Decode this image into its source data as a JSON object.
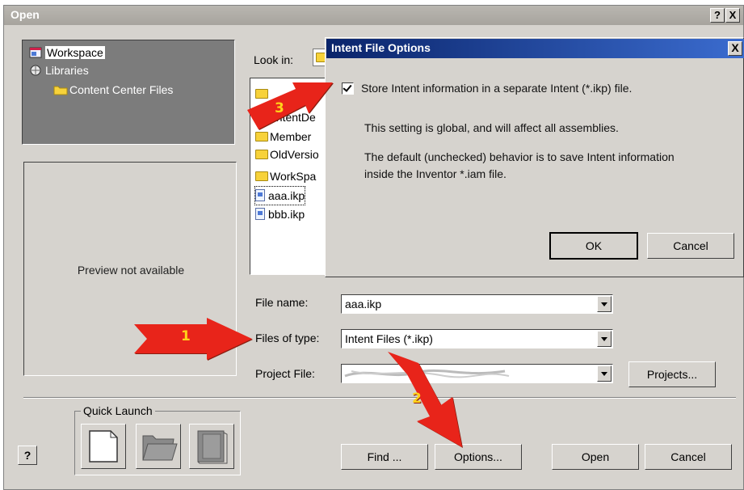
{
  "window": {
    "title": "Open",
    "help_button": "?",
    "close_button": "X"
  },
  "project_tree": {
    "items": [
      {
        "label": "Workspace",
        "icon": "workspace-icon"
      },
      {
        "label": "Libraries",
        "icon": "libraries-icon"
      },
      {
        "label": "Content Center Files",
        "icon": "folder-icon"
      }
    ]
  },
  "preview": {
    "text": "Preview not available"
  },
  "browser": {
    "look_in_label": "Look in:",
    "files": [
      {
        "name": "",
        "type": "folder"
      },
      {
        "name": "ontentDe",
        "type": "folder"
      },
      {
        "name": "Member",
        "type": "folder"
      },
      {
        "name": "OldVersio",
        "type": "folder"
      },
      {
        "name": "WorkSpa",
        "type": "folder"
      },
      {
        "name": "aaa.ikp",
        "type": "file"
      },
      {
        "name": "bbb.ikp",
        "type": "file"
      }
    ]
  },
  "fields": {
    "file_name_label": "File name:",
    "file_name_value": "aaa.ikp",
    "files_of_type_label": "Files of type:",
    "files_of_type_value": "Intent Files (*.ikp)",
    "project_file_label": "Project File:",
    "project_file_value": "",
    "projects_button": "Projects..."
  },
  "quick_launch": {
    "label": "Quick Launch"
  },
  "buttons": {
    "help": "?",
    "find": "Find ...",
    "options": "Options...",
    "open": "Open",
    "cancel": "Cancel"
  },
  "intent_dialog": {
    "title": "Intent File Options",
    "close": "X",
    "checkbox_label": "Store Intent information in a separate Intent (*.ikp) file.",
    "checkbox_checked": true,
    "note_line1": "This setting is global, and will affect all assemblies.",
    "note_line2": "The default (unchecked) behavior is to save Intent information",
    "note_line3": "inside the Inventor *.iam file.",
    "ok": "OK",
    "cancel": "Cancel"
  },
  "annotations": {
    "arrow1": "1",
    "arrow2": "2",
    "arrow3": "3",
    "arrow_color": "#e8241a",
    "number_color": "#ffd21a"
  }
}
